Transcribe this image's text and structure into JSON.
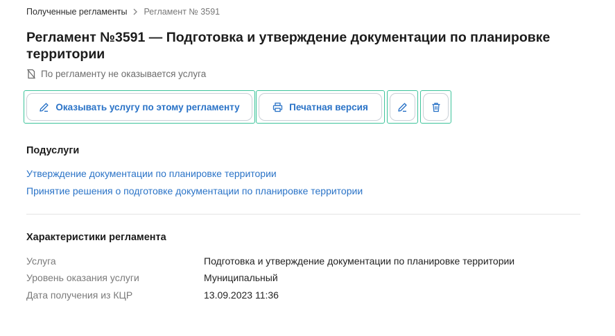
{
  "breadcrumb": {
    "items": [
      "Полученные регламенты"
    ],
    "current": "Регламент № 3591"
  },
  "page": {
    "title": "Регламент №3591 — Подготовка и утверждение документации по планировке территории",
    "notice": "По регламенту не оказывается услуга"
  },
  "toolbar": {
    "provide_label": "Оказывать услугу по этому регламенту",
    "print_label": "Печатная версия"
  },
  "subservices": {
    "title": "Подуслуги",
    "items": [
      "Утверждение документации по планировке территории",
      "Принятие решения о подготовке документации по планировке территории"
    ]
  },
  "characteristics": {
    "title": "Характеристики регламента",
    "rows": [
      {
        "label": "Услуга",
        "value": "Подготовка и утверждение документации по планировке территории"
      },
      {
        "label": "Уровень оказания услуги",
        "value": "Муниципальный"
      },
      {
        "label": "Дата получения из КЦР",
        "value": "13.09.2023 11:36"
      }
    ]
  },
  "colors": {
    "accent": "#2a73c7",
    "highlight_frame": "#3cc39a"
  }
}
